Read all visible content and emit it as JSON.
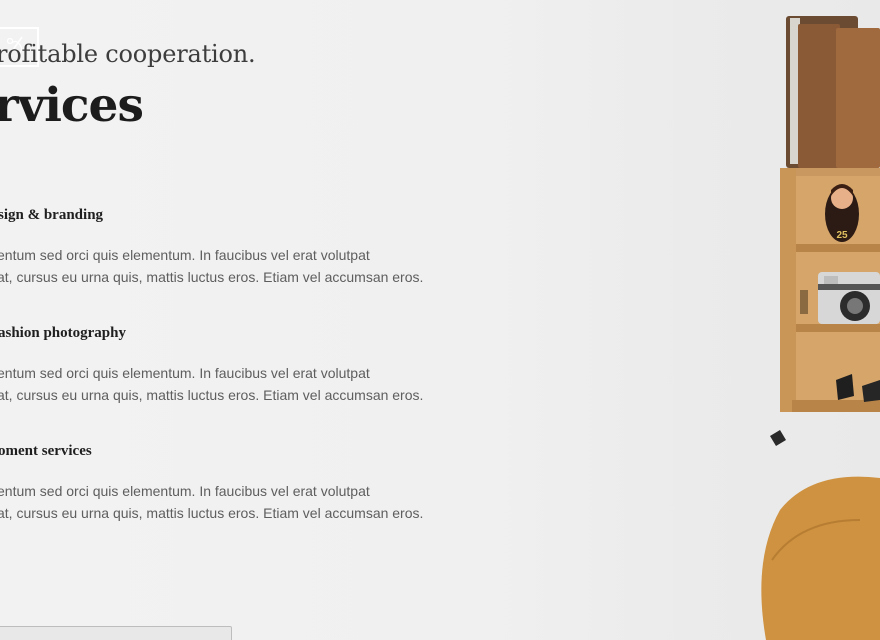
{
  "hero": {
    "eyebrow": "rofitable cooperation.",
    "heading": "rvices"
  },
  "services": [
    {
      "title": "sign & branding",
      "desc_line1": "entum sed orci quis elementum. In faucibus vel erat volutpat",
      "desc_line2": "at, cursus eu urna quis, mattis luctus eros. Etiam vel accumsan eros."
    },
    {
      "title": "ashion photography",
      "desc_line1": "entum sed orci quis elementum. In faucibus vel erat volutpat",
      "desc_line2": "at, cursus eu urna quis, mattis luctus eros. Etiam vel accumsan eros."
    },
    {
      "title": "oment services",
      "desc_line1": "entum sed orci quis elementum. In faucibus vel erat volutpat",
      "desc_line2": "at, cursus eu urna quis, mattis luctus eros. Etiam vel accumsan eros."
    }
  ],
  "decor": {
    "shelf_figure_number": "25"
  }
}
